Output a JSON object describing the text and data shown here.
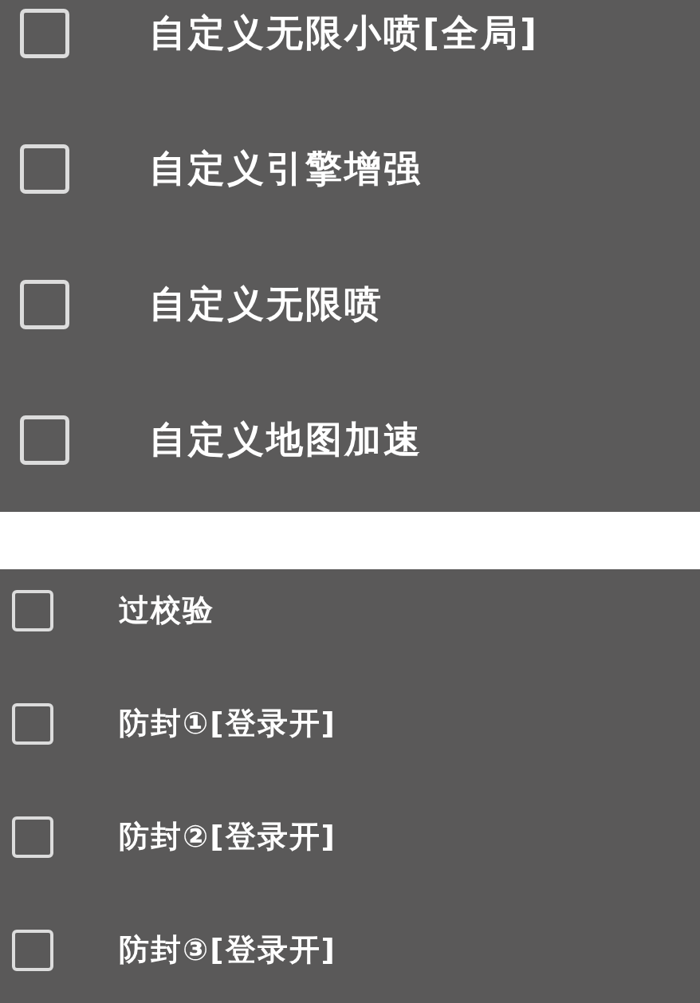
{
  "panels": [
    {
      "kind": "large",
      "items": [
        {
          "label": "自定义无限小喷[全局]",
          "checked": false
        },
        {
          "label": "自定义引擎增强",
          "checked": false
        },
        {
          "label": "自定义无限喷",
          "checked": false
        },
        {
          "label": "自定义地图加速",
          "checked": false
        }
      ]
    },
    {
      "kind": "compact",
      "items": [
        {
          "label": "过校验",
          "checked": false
        },
        {
          "label": "防封①[登录开]",
          "checked": false
        },
        {
          "label": "防封②[登录开]",
          "checked": false
        },
        {
          "label": "防封③[登录开]",
          "checked": false
        }
      ]
    }
  ]
}
